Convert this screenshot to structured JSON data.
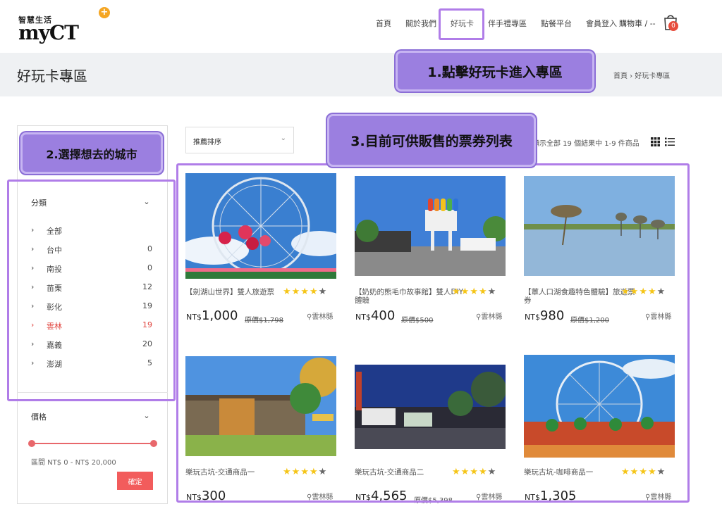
{
  "header": {
    "logo_sub": "智慧生活",
    "logo_main": "myCT",
    "nav": [
      "首頁",
      "關於我們",
      "好玩卡",
      "伴手禮專區",
      "點餐平台",
      "會員登入"
    ],
    "cart_label": "購物車 / --",
    "cart_count": "0"
  },
  "title_band": {
    "title": "好玩卡專區",
    "breadcrumb": "首頁 › 好玩卡專區"
  },
  "callouts": {
    "step1": "1.點擊好玩卡進入專區",
    "step2": "2.選擇想去的城市",
    "step3": "3.目前可供販售的票券列表"
  },
  "toolbar": {
    "sort_label": "推薦排序",
    "result_text": "顯示全部 19 個結果中 1-9 件商品"
  },
  "sidebar": {
    "category_head": "分類",
    "categories": [
      {
        "label": "全部",
        "count": ""
      },
      {
        "label": "台中",
        "count": "0"
      },
      {
        "label": "南投",
        "count": "0"
      },
      {
        "label": "苗栗",
        "count": "12"
      },
      {
        "label": "彰化",
        "count": "19"
      },
      {
        "label": "雲林",
        "count": "19"
      },
      {
        "label": "嘉義",
        "count": "20"
      },
      {
        "label": "澎湖",
        "count": "5"
      }
    ],
    "selected_category": "雲林",
    "price_head": "價格",
    "price_range": "區間 NT$ 0 - NT$ 20,000",
    "price_min_fraction": 0,
    "price_max_fraction": 1,
    "confirm_label": "確定"
  },
  "products": [
    {
      "name": "【劍湖山世界】雙人旅遊票",
      "currency": "NT$",
      "price": "1,000",
      "original": "原價$1,798",
      "location": "雲林縣",
      "rating": 4,
      "max_rating": 5
    },
    {
      "name": "【奶奶的熊毛巾故事館】雙人DIY體驗",
      "currency": "NT$",
      "price": "400",
      "original": "原價$500",
      "location": "雲林縣",
      "rating": 4,
      "max_rating": 5
    },
    {
      "name": "【蕈人口湖食趣特色體驗】旅遊票券",
      "currency": "NT$",
      "price": "980",
      "original": "原價$1,200",
      "location": "雲林縣",
      "rating": 4,
      "max_rating": 5
    },
    {
      "name": "樂玩古坑-交通商品一",
      "currency": "NT$",
      "price": "300",
      "original": "",
      "location": "雲林縣",
      "rating": 4,
      "max_rating": 5
    },
    {
      "name": "樂玩古坑-交通商品二",
      "currency": "NT$",
      "price": "4,565",
      "original": "原價$5,398",
      "location": "雲林縣",
      "rating": 4,
      "max_rating": 5
    },
    {
      "name": "樂玩古坑-咖啡商品一",
      "currency": "NT$",
      "price": "1,305",
      "original": "",
      "location": "雲林縣",
      "rating": 4,
      "max_rating": 5
    }
  ],
  "colors": {
    "callout_purple": "#9b7fe0",
    "highlight_border": "#b07de8",
    "accent_red": "#e0443e",
    "star_yellow": "#f5c518"
  }
}
